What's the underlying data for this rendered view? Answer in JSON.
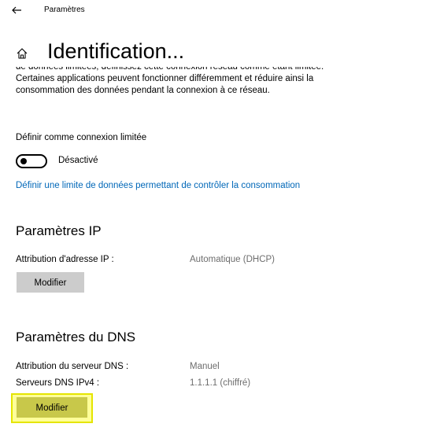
{
  "window": {
    "title": "Paramètres"
  },
  "header": {
    "title": "Identification..."
  },
  "metered": {
    "description": "de données limitées, définissez cette connexion réseau comme étant limitée. Certaines applications peuvent fonctionner différemment et réduire ainsi la consommation des données pendant la connexion à ce réseau.",
    "setting_label": "Définir comme connexion limitée",
    "toggle_state": "Désactivé",
    "toggle_on": false,
    "data_limit_link": "Définir une limite de données permettant de contrôler la consommation"
  },
  "ip_settings": {
    "title": "Paramètres IP",
    "assignment_label": "Attribution d'adresse IP :",
    "assignment_value": "Automatique (DHCP)",
    "edit_button": "Modifier"
  },
  "dns_settings": {
    "title": "Paramètres du DNS",
    "assignment_label": "Attribution du serveur DNS :",
    "assignment_value": "Manuel",
    "ipv4_label": "Serveurs DNS IPv4 :",
    "ipv4_value": "1.1.1.1 (chiffré)",
    "edit_button": "Modifier"
  },
  "colors": {
    "link": "#0067b8",
    "button": "#cccccc",
    "highlight": "#ffff99",
    "secondary_text": "#6d6d6d"
  },
  "icons": {
    "back": "back-arrow-icon",
    "home": "home-icon"
  }
}
